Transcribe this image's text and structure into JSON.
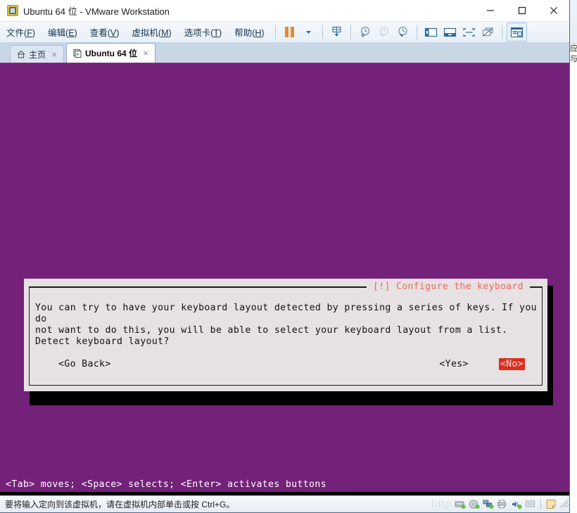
{
  "window": {
    "title": "Ubuntu 64 位 - VMware Workstation",
    "app_icon": "vmware-logo-icon",
    "controls": {
      "minimize": "minimize-icon",
      "maximize": "maximize-icon",
      "close": "close-icon"
    }
  },
  "menu": {
    "items": [
      {
        "label": "文件",
        "accel": "F"
      },
      {
        "label": "编辑",
        "accel": "E"
      },
      {
        "label": "查看",
        "accel": "V"
      },
      {
        "label": "虚拟机",
        "accel": "M"
      },
      {
        "label": "选项卡",
        "accel": "T"
      },
      {
        "label": "帮助",
        "accel": "H"
      }
    ]
  },
  "toolbar": {
    "buttons": [
      "pause-icon",
      "dropdown-arrow-icon",
      "send-ctrl-alt-del-icon",
      "take-snapshot-icon",
      "revert-snapshot-icon",
      "snapshot-manager-icon",
      "show-library-icon",
      "show-console-view-icon",
      "enter-fullscreen-icon",
      "unity-mode-icon",
      "show-thumbnail-bar-icon"
    ]
  },
  "tabs": [
    {
      "label": "主页",
      "icon": "home-icon",
      "active": false,
      "close": "×"
    },
    {
      "label": "Ubuntu 64 位",
      "icon": "vm-icon",
      "active": true,
      "close": "×"
    }
  ],
  "vm_screen": {
    "background_color": "#74217a",
    "dialog": {
      "title": "[!] Configure the keyboard",
      "title_color": "#e8675f",
      "body": "You can try to have your keyboard layout detected by pressing a series of keys. If you do\nnot want to do this, you will be able to select your keyboard layout from a list.",
      "question": "Detect keyboard layout?",
      "buttons": {
        "go_back": "<Go Back>",
        "yes": "<Yes>",
        "no": "<No>",
        "selected": "<No>",
        "selected_bg": "#e02b1d"
      }
    },
    "help_line": "<Tab> moves; <Space> selects; <Enter> activates buttons"
  },
  "status_bar": {
    "message": "要将输入定向到该虚拟机，请在虚拟机内部单击或按 Ctrl+G。",
    "ghost_text": "http",
    "devices": [
      "hard-disk-icon",
      "cd-dvd-icon",
      "network-adapter-icon",
      "printer-icon",
      "sound-card-icon",
      "usb-display-icon",
      "notes-icon"
    ],
    "resize_grip": "resize-grip-icon"
  },
  "background_window": {
    "glyphs": "应\n与"
  }
}
